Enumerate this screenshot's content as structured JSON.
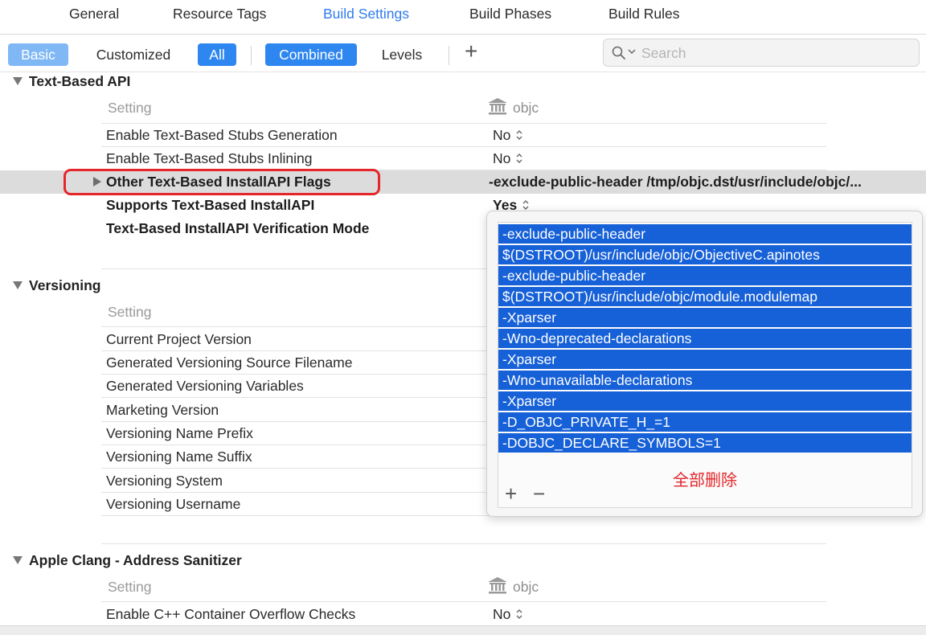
{
  "tabs": [
    "General",
    "Resource Tags",
    "Build Settings",
    "Build Phases",
    "Build Rules"
  ],
  "active_tab": "Build Settings",
  "filters": {
    "basic": "Basic",
    "customized": "Customized",
    "all": "All",
    "combined": "Combined",
    "levels": "Levels",
    "add": "+"
  },
  "search": {
    "placeholder": "Search"
  },
  "sections": {
    "text_based_api": {
      "title": "Text-Based API",
      "setting_header": "Setting",
      "target_header": "objc",
      "rows": [
        {
          "label": "Enable Text-Based Stubs Generation",
          "value": "No"
        },
        {
          "label": "Enable Text-Based Stubs Inlining",
          "value": "No"
        },
        {
          "label": "Other Text-Based InstallAPI Flags",
          "value": "-exclude-public-header /tmp/objc.dst/usr/include/objc/..."
        },
        {
          "label": "Supports Text-Based InstallAPI",
          "value": "Yes"
        },
        {
          "label": "Text-Based InstallAPI Verification Mode",
          "value": ""
        }
      ]
    },
    "versioning": {
      "title": "Versioning",
      "setting_header": "Setting",
      "rows": [
        "Current Project Version",
        "Generated Versioning Source Filename",
        "Generated Versioning Variables",
        "Marketing Version",
        "Versioning Name Prefix",
        "Versioning Name Suffix",
        "Versioning System",
        "Versioning Username"
      ]
    },
    "address_sanitizer": {
      "title": "Apple Clang - Address Sanitizer",
      "setting_header": "Setting",
      "target_header": "objc",
      "rows": [
        {
          "label": "Enable C++ Container Overflow Checks",
          "value": "No"
        }
      ]
    }
  },
  "popover": {
    "flags": [
      "-exclude-public-header",
      "$(DSTROOT)/usr/include/objc/ObjectiveC.apinotes",
      "-exclude-public-header",
      "$(DSTROOT)/usr/include/objc/module.modulemap",
      "-Xparser",
      "-Wno-deprecated-declarations",
      "-Xparser",
      "-Wno-unavailable-declarations",
      "-Xparser",
      "-D_OBJC_PRIVATE_H_=1",
      "-DOBJC_DECLARE_SYMBOLS=1"
    ],
    "annotation": "全部删除",
    "add": "+",
    "remove": "−"
  },
  "colors": {
    "accent": "#2e86f0",
    "selection": "#1660d8",
    "annotation_red": "#e5262b"
  }
}
